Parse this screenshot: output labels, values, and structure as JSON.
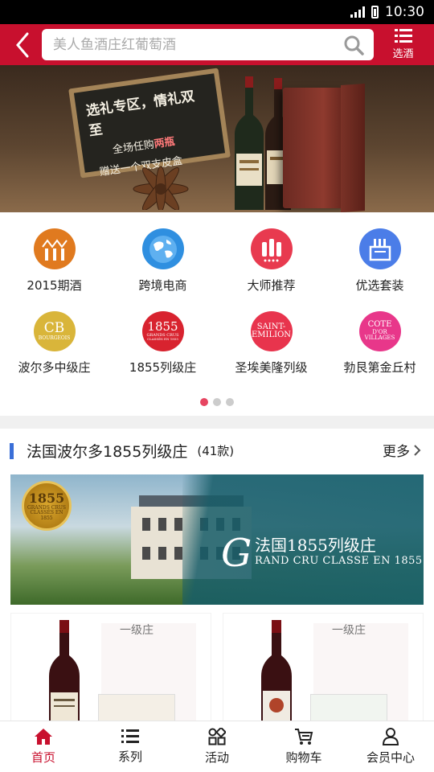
{
  "status": {
    "time": "10:30"
  },
  "header": {
    "search_placeholder": "美人鱼酒庄红葡萄酒",
    "filter_label": "选酒"
  },
  "banner": {
    "line1": "选礼专区，情礼双至",
    "line2_prefix": "全场任购",
    "line2_highlight": "两瓶",
    "line3": "赠送一个双支皮盒"
  },
  "categories": [
    {
      "label": "2015期酒",
      "icon": "vintage-2015-icon",
      "color": "#e07a1f"
    },
    {
      "label": "跨境电商",
      "icon": "globe-icon",
      "color": "#2f8fe0"
    },
    {
      "label": "大师推荐",
      "icon": "master-pick-icon",
      "color": "#e83a4f"
    },
    {
      "label": "优选套装",
      "icon": "gift-box-icon",
      "color": "#4b7de8"
    },
    {
      "label": "波尔多中级庄",
      "icon": "cru-bourgeois-icon",
      "color": "#d9b53a",
      "badge": [
        "CB",
        "BOURGEOIS"
      ]
    },
    {
      "label": "1855列级庄",
      "icon": "1855-icon",
      "color": "#d8232f",
      "badge": [
        "1855",
        "GRANDS CRUS",
        "CLASSÉS EN 1855"
      ]
    },
    {
      "label": "圣埃美隆列级",
      "icon": "saint-emilion-icon",
      "color": "#e8344d",
      "badge": [
        "SAINT-",
        "EMILION"
      ]
    },
    {
      "label": "勃艮第金丘村",
      "icon": "cote-dor-icon",
      "color": "#e8378a",
      "badge": [
        "COTE",
        "D'OR",
        "VILLAGES"
      ]
    }
  ],
  "pager": {
    "count": 3,
    "active": 0
  },
  "section": {
    "title": "法国波尔多1855列级庄",
    "count": "(41款)",
    "more_label": "更多",
    "banner_seal_big": "1855",
    "banner_seal_small": "GRANDS CRUS CLASSÉS EN 1855",
    "banner_initial": "G",
    "banner_title": "法国1855列级庄",
    "banner_subtitle": "RAND CRU CLASSE EN 1855"
  },
  "products": [
    {
      "tag": "一级庄"
    },
    {
      "tag": "一级庄"
    }
  ],
  "nav": [
    {
      "label": "首页",
      "icon": "home-icon",
      "active": true
    },
    {
      "label": "系列",
      "icon": "list-icon",
      "active": false
    },
    {
      "label": "活动",
      "icon": "activity-icon",
      "active": false
    },
    {
      "label": "购物车",
      "icon": "cart-icon",
      "active": false
    },
    {
      "label": "会员中心",
      "icon": "user-icon",
      "active": false
    }
  ],
  "colors": {
    "brand": "#c8102e",
    "accent_bar": "#3a6fd8",
    "dot_active": "#e64561"
  }
}
